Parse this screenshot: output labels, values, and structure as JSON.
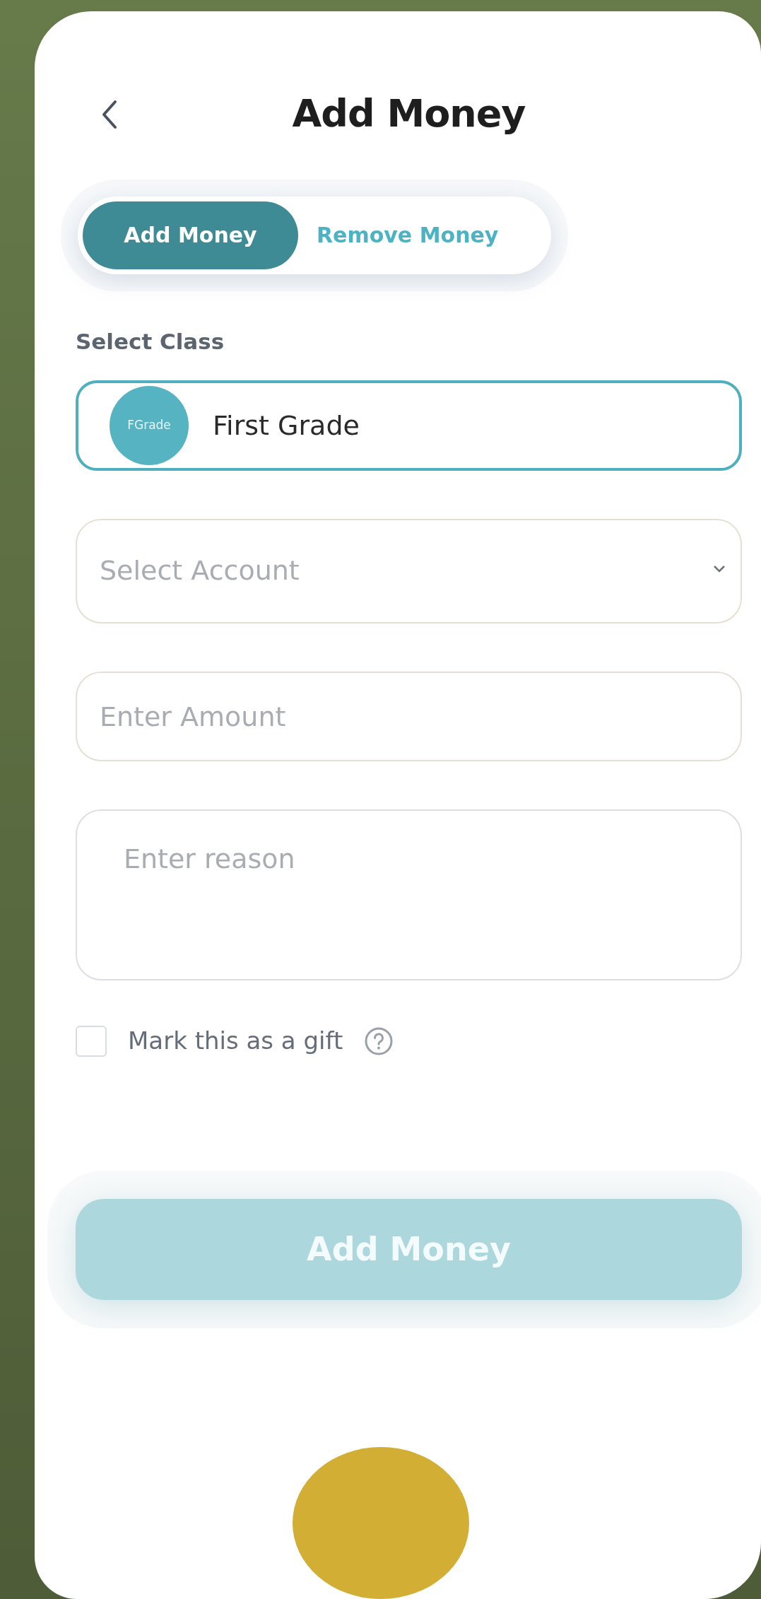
{
  "header": {
    "title": "Add Money"
  },
  "tabs": [
    {
      "label": "Add Money",
      "selected": true
    },
    {
      "label": "Remove Money",
      "selected": false
    }
  ],
  "class_field": {
    "label": "Select Class",
    "avatar": "FGrade",
    "value": "First Grade"
  },
  "account_select": {
    "placeholder": "Select Account"
  },
  "amount_field": {
    "placeholder": "Enter Amount"
  },
  "reason_field": {
    "placeholder": "Enter reason"
  },
  "gift_checkbox": {
    "label": "Mark this as a gift",
    "checked": false
  },
  "submit_button": {
    "label": "Add Money",
    "disabled": true
  }
}
